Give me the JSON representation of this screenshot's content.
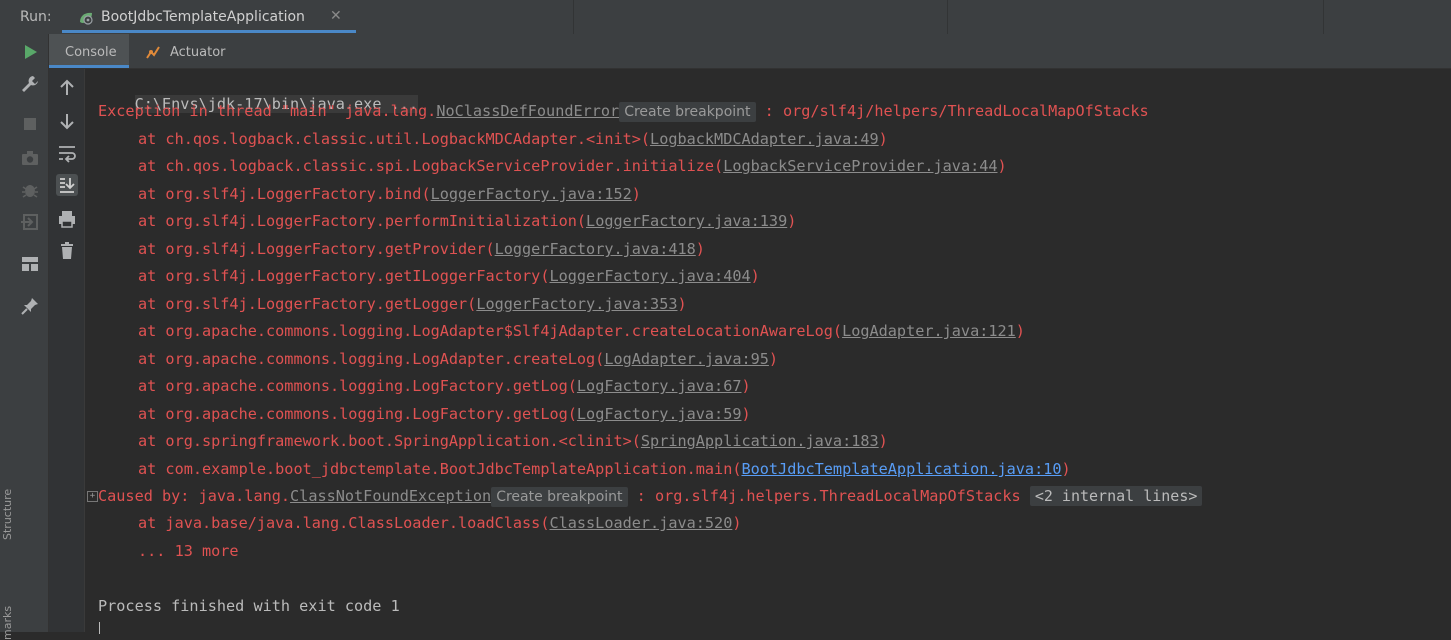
{
  "run_bar": {
    "label": "Run:",
    "tab_title": "BootJdbcTemplateApplication",
    "close_glyph": "✕",
    "tab_icon": "spring-boot-icon",
    "accent": "#4a88c7"
  },
  "sub_tabs": [
    {
      "label": "Console",
      "active": true
    },
    {
      "label": "Actuator",
      "icon": "actuator-icon",
      "active": false
    }
  ],
  "edge_labels": [
    "Structure",
    "marks"
  ],
  "left_tools": [
    "run-icon",
    "wrench-icon",
    "stop-icon",
    "camera-icon",
    "debug-icon",
    "login-icon",
    "layout-icon",
    "pin-icon"
  ],
  "console_tools": [
    "arrow-up-icon",
    "arrow-down-icon",
    "soft-wrap-icon",
    "scroll-to-end-icon",
    "print-icon",
    "trash-icon"
  ],
  "console": {
    "command": "C:\\Envs\\jdk-17\\bin\\java.exe ...",
    "exception": {
      "prefix": "Exception in thread \"main\" java.lang.",
      "link": "NoClassDefFoundError",
      "chip": "Create breakpoint",
      "suffix": " : org/slf4j/helpers/ThreadLocalMapOfStacks"
    },
    "trace": [
      {
        "text": "at ch.qos.logback.classic.util.LogbackMDCAdapter.<init>(",
        "link": "LogbackMDCAdapter.java:49",
        "end": ")"
      },
      {
        "text": "at ch.qos.logback.classic.spi.LogbackServiceProvider.initialize(",
        "link": "LogbackServiceProvider.java:44",
        "end": ")"
      },
      {
        "text": "at org.slf4j.LoggerFactory.bind(",
        "link": "LoggerFactory.java:152",
        "end": ")"
      },
      {
        "text": "at org.slf4j.LoggerFactory.performInitialization(",
        "link": "LoggerFactory.java:139",
        "end": ")"
      },
      {
        "text": "at org.slf4j.LoggerFactory.getProvider(",
        "link": "LoggerFactory.java:418",
        "end": ")"
      },
      {
        "text": "at org.slf4j.LoggerFactory.getILoggerFactory(",
        "link": "LoggerFactory.java:404",
        "end": ")"
      },
      {
        "text": "at org.slf4j.LoggerFactory.getLogger(",
        "link": "LoggerFactory.java:353",
        "end": ")"
      },
      {
        "text": "at org.apache.commons.logging.LogAdapter$Slf4jAdapter.createLocationAwareLog(",
        "link": "LogAdapter.java:121",
        "end": ")"
      },
      {
        "text": "at org.apache.commons.logging.LogAdapter.createLog(",
        "link": "LogAdapter.java:95",
        "end": ")"
      },
      {
        "text": "at org.apache.commons.logging.LogFactory.getLog(",
        "link": "LogFactory.java:67",
        "end": ")"
      },
      {
        "text": "at org.apache.commons.logging.LogFactory.getLog(",
        "link": "LogFactory.java:59",
        "end": ")"
      },
      {
        "text": "at org.springframework.boot.SpringApplication.<clinit>(",
        "link": "SpringApplication.java:183",
        "end": ")"
      },
      {
        "text": "at com.example.boot_jdbctemplate.BootJdbcTemplateApplication.main(",
        "link": "BootJdbcTemplateApplication.java:10",
        "end": ")"
      }
    ],
    "caused_by": {
      "fold_glyph": "+",
      "prefix": "Caused by: java.lang.",
      "link": "ClassNotFoundException",
      "chip": "Create breakpoint",
      "middle": " : org.slf4j.helpers.ThreadLocalMapOfStacks ",
      "internal_chip": "<2 internal lines>"
    },
    "caused_trace": [
      {
        "text": "at java.base/java.lang.ClassLoader.loadClass(",
        "link": "ClassLoader.java:520",
        "end": ")"
      }
    ],
    "more": "... 13 more",
    "exit": "Process finished with exit code 1",
    "colors": {
      "error": "#e05252",
      "link": "#8c8c8c",
      "project_link": "#589df6",
      "plain": "#bbbbbb"
    }
  }
}
